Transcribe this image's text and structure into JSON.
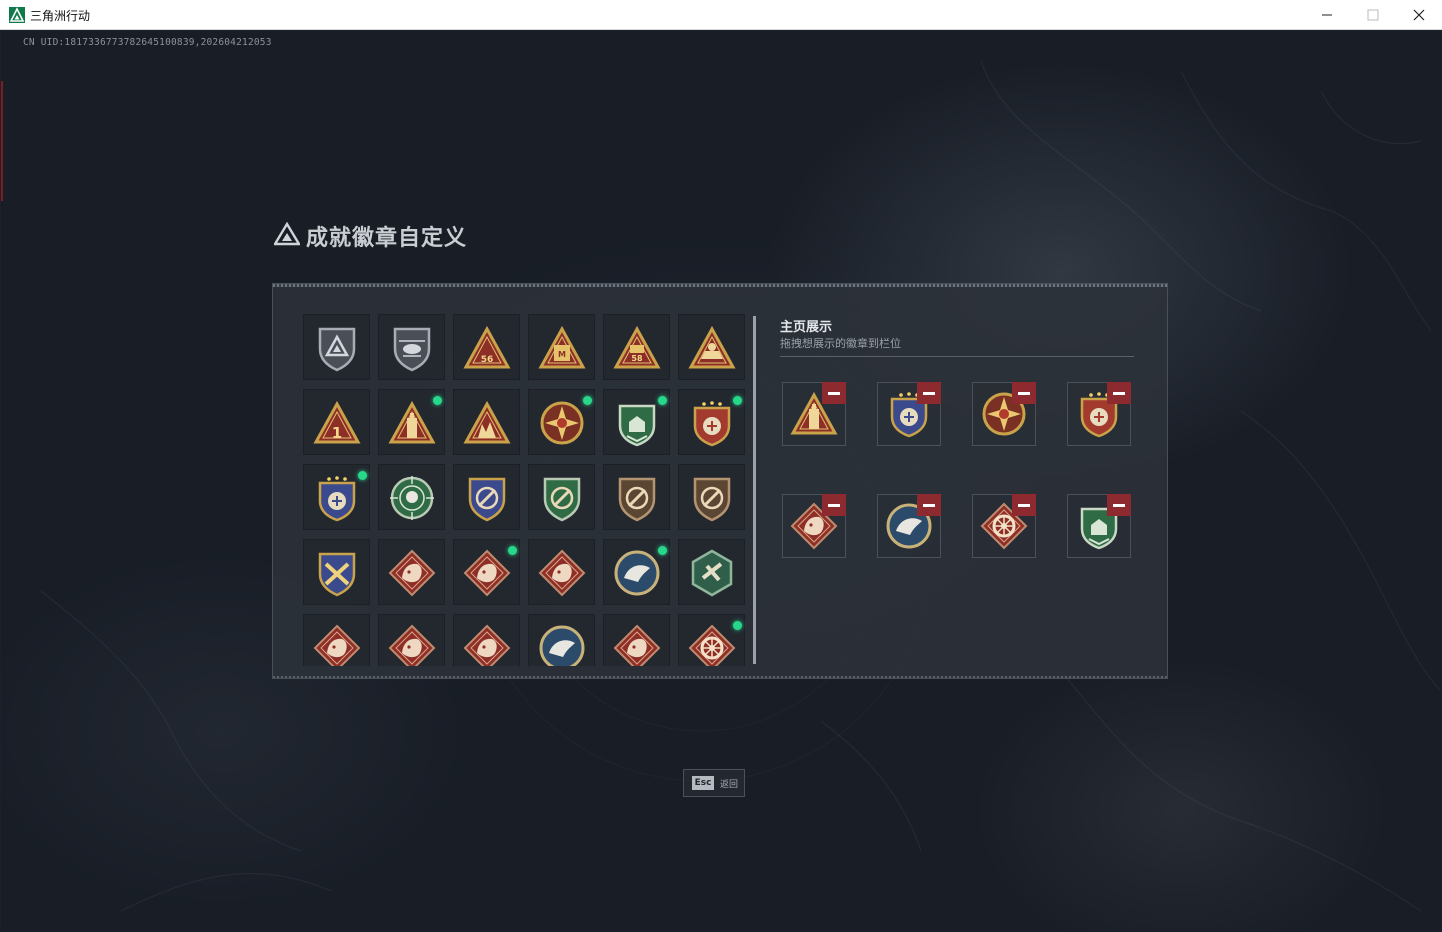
{
  "window": {
    "title": "三角洲行动",
    "minimize_icon": "minimize-icon",
    "maximize_icon": "maximize-icon",
    "close_icon": "close-icon"
  },
  "uid_text": "CN UID:1817336773782645100839,202604212053",
  "panel": {
    "title": "成就徽章自定义",
    "title_icon": "delta-logo-icon"
  },
  "owned_badges": [
    {
      "icon": "shield-delta-badge",
      "new": false
    },
    {
      "icon": "helicopter-badge",
      "new": false
    },
    {
      "icon": "triangle-56-badge",
      "new": false
    },
    {
      "icon": "triangle-m-badge",
      "new": false
    },
    {
      "icon": "triangle-58-badge",
      "new": false
    },
    {
      "icon": "triangle-boat-badge",
      "new": false
    },
    {
      "icon": "triangle-1-badge",
      "new": false
    },
    {
      "icon": "triangle-tower-badge",
      "new": true
    },
    {
      "icon": "triangle-soldiers-badge",
      "new": false
    },
    {
      "icon": "star-compass-badge",
      "new": true
    },
    {
      "icon": "green-shield-badge",
      "new": true
    },
    {
      "icon": "red-gold-crest-badge",
      "new": true
    },
    {
      "icon": "blue-eagle-crest-badge",
      "new": true
    },
    {
      "icon": "green-skull-scope-badge",
      "new": false
    },
    {
      "icon": "gold-no-gun-badge",
      "new": false
    },
    {
      "icon": "green-no-gun-badge",
      "new": false
    },
    {
      "icon": "bronze-no-gun-badge",
      "new": false
    },
    {
      "icon": "bronze-no-gun-badge-2",
      "new": false
    },
    {
      "icon": "gold-crossed-guns-badge",
      "new": false
    },
    {
      "icon": "wolf-diamond-badge",
      "new": false
    },
    {
      "icon": "tiger-diamond-badge",
      "new": true
    },
    {
      "icon": "horse-diamond-badge",
      "new": false
    },
    {
      "icon": "eagle-circle-badge",
      "new": true
    },
    {
      "icon": "hexagon-eagle-badge",
      "new": false
    },
    {
      "icon": "dragon-diamond-badge",
      "new": false
    },
    {
      "icon": "dragon-diamond-badge-2",
      "new": false
    },
    {
      "icon": "monkey-diamond-badge",
      "new": false
    },
    {
      "icon": "wolf-circle-badge",
      "new": false
    },
    {
      "icon": "boar-diamond-badge",
      "new": false
    },
    {
      "icon": "wheel-diamond-badge",
      "new": true
    }
  ],
  "display": {
    "title": "主页展示",
    "subtitle": "拖拽想展示的徽章到栏位",
    "slots": [
      {
        "icon": "triangle-tower-badge",
        "remove": "remove-icon"
      },
      {
        "icon": "blue-eagle-crest-badge",
        "remove": "remove-icon"
      },
      {
        "icon": "star-compass-badge",
        "remove": "remove-icon"
      },
      {
        "icon": "red-gold-crest-badge",
        "remove": "remove-icon"
      },
      {
        "icon": "tiger-diamond-badge",
        "remove": "remove-icon"
      },
      {
        "icon": "eagle-circle-badge",
        "remove": "remove-icon"
      },
      {
        "icon": "wheel-diamond-badge",
        "remove": "remove-icon"
      },
      {
        "icon": "green-shield-badge",
        "remove": "remove-icon"
      }
    ]
  },
  "esc": {
    "key": "Esc",
    "label": "返回"
  },
  "colors": {
    "badge_gold": "#c9a24a",
    "badge_red": "#8e2f27",
    "new_dot": "#27d88a",
    "remove_btn": "#8d2a2f"
  }
}
